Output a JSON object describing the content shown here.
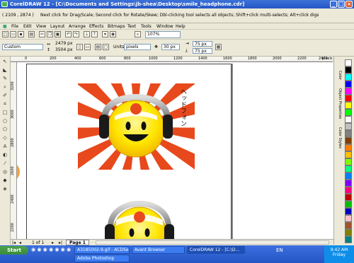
{
  "window": {
    "title": "CorelDRAW 12 - [C:\\Documents and Settings\\jb-shea\\Desktop\\smile_headphone.cdr]",
    "status_coord": "( 2109 , 2874 )",
    "status_hint": "Next click for Drag/Scale; Second click for Rotate/Skew; Dbl-clicking tool selects all objects; Shift+click multi-selects; Alt+click digs"
  },
  "menu": [
    "File",
    "Edit",
    "View",
    "Layout",
    "Arrange",
    "Effects",
    "Bitmaps",
    "Text",
    "Tools",
    "Window",
    "Help"
  ],
  "toolbar": {
    "zoom": "107%"
  },
  "property_bar": {
    "preset": "Custom",
    "width": "2479 px",
    "height": "3504 px",
    "units_label": "Units:",
    "units": "pixels",
    "nudge": "30 px",
    "dup_x": "75 px",
    "dup_y": "75 px"
  },
  "rulers": {
    "h_ticks": [
      "0",
      "200",
      "400",
      "600",
      "800",
      "1000",
      "1200",
      "1400",
      "1600",
      "1800",
      "2000",
      "2200",
      "2400"
    ],
    "v_ticks": [
      "3200",
      "3000",
      "2800",
      "2600",
      "2400",
      "2200"
    ],
    "unit": "pixels"
  },
  "canvas": {
    "vertical_text": "ヘッドフォン"
  },
  "page_nav": {
    "count": "1 of 1",
    "tab": "Page 1"
  },
  "dockers": [
    "Color",
    "Object Properties",
    "Color Styles"
  ],
  "palette_colors": [
    "#ffffff",
    "#000000",
    "#00ffff",
    "#0000ff",
    "#ff00ff",
    "#ff0000",
    "#ffff00",
    "#00ff00",
    "#ffffff",
    "#c0c0c0",
    "#808080",
    "#7f3f00",
    "#ff7f00",
    "#ffbf00",
    "#7fff00",
    "#00ff7f",
    "#007fff",
    "#7f00ff",
    "#ff007f",
    "#bf0000",
    "#00bf00",
    "#0000bf",
    "#ffc0cb",
    "#a0522d",
    "#808000",
    "#008080"
  ],
  "taskbar": {
    "start": "Start",
    "tasks": [
      "A3185002-9.gif - ACDSe...",
      "Avant Browser",
      "CorelDRAW 12 - [C:\\D...",
      "Adobe Photoshop"
    ],
    "time": "9:42 AM",
    "day": "Friday"
  },
  "colors": {
    "sunburst_red": "#e8491c",
    "smiley_yellow": "#ffe600",
    "headphone_black": "#1a1a1a"
  }
}
